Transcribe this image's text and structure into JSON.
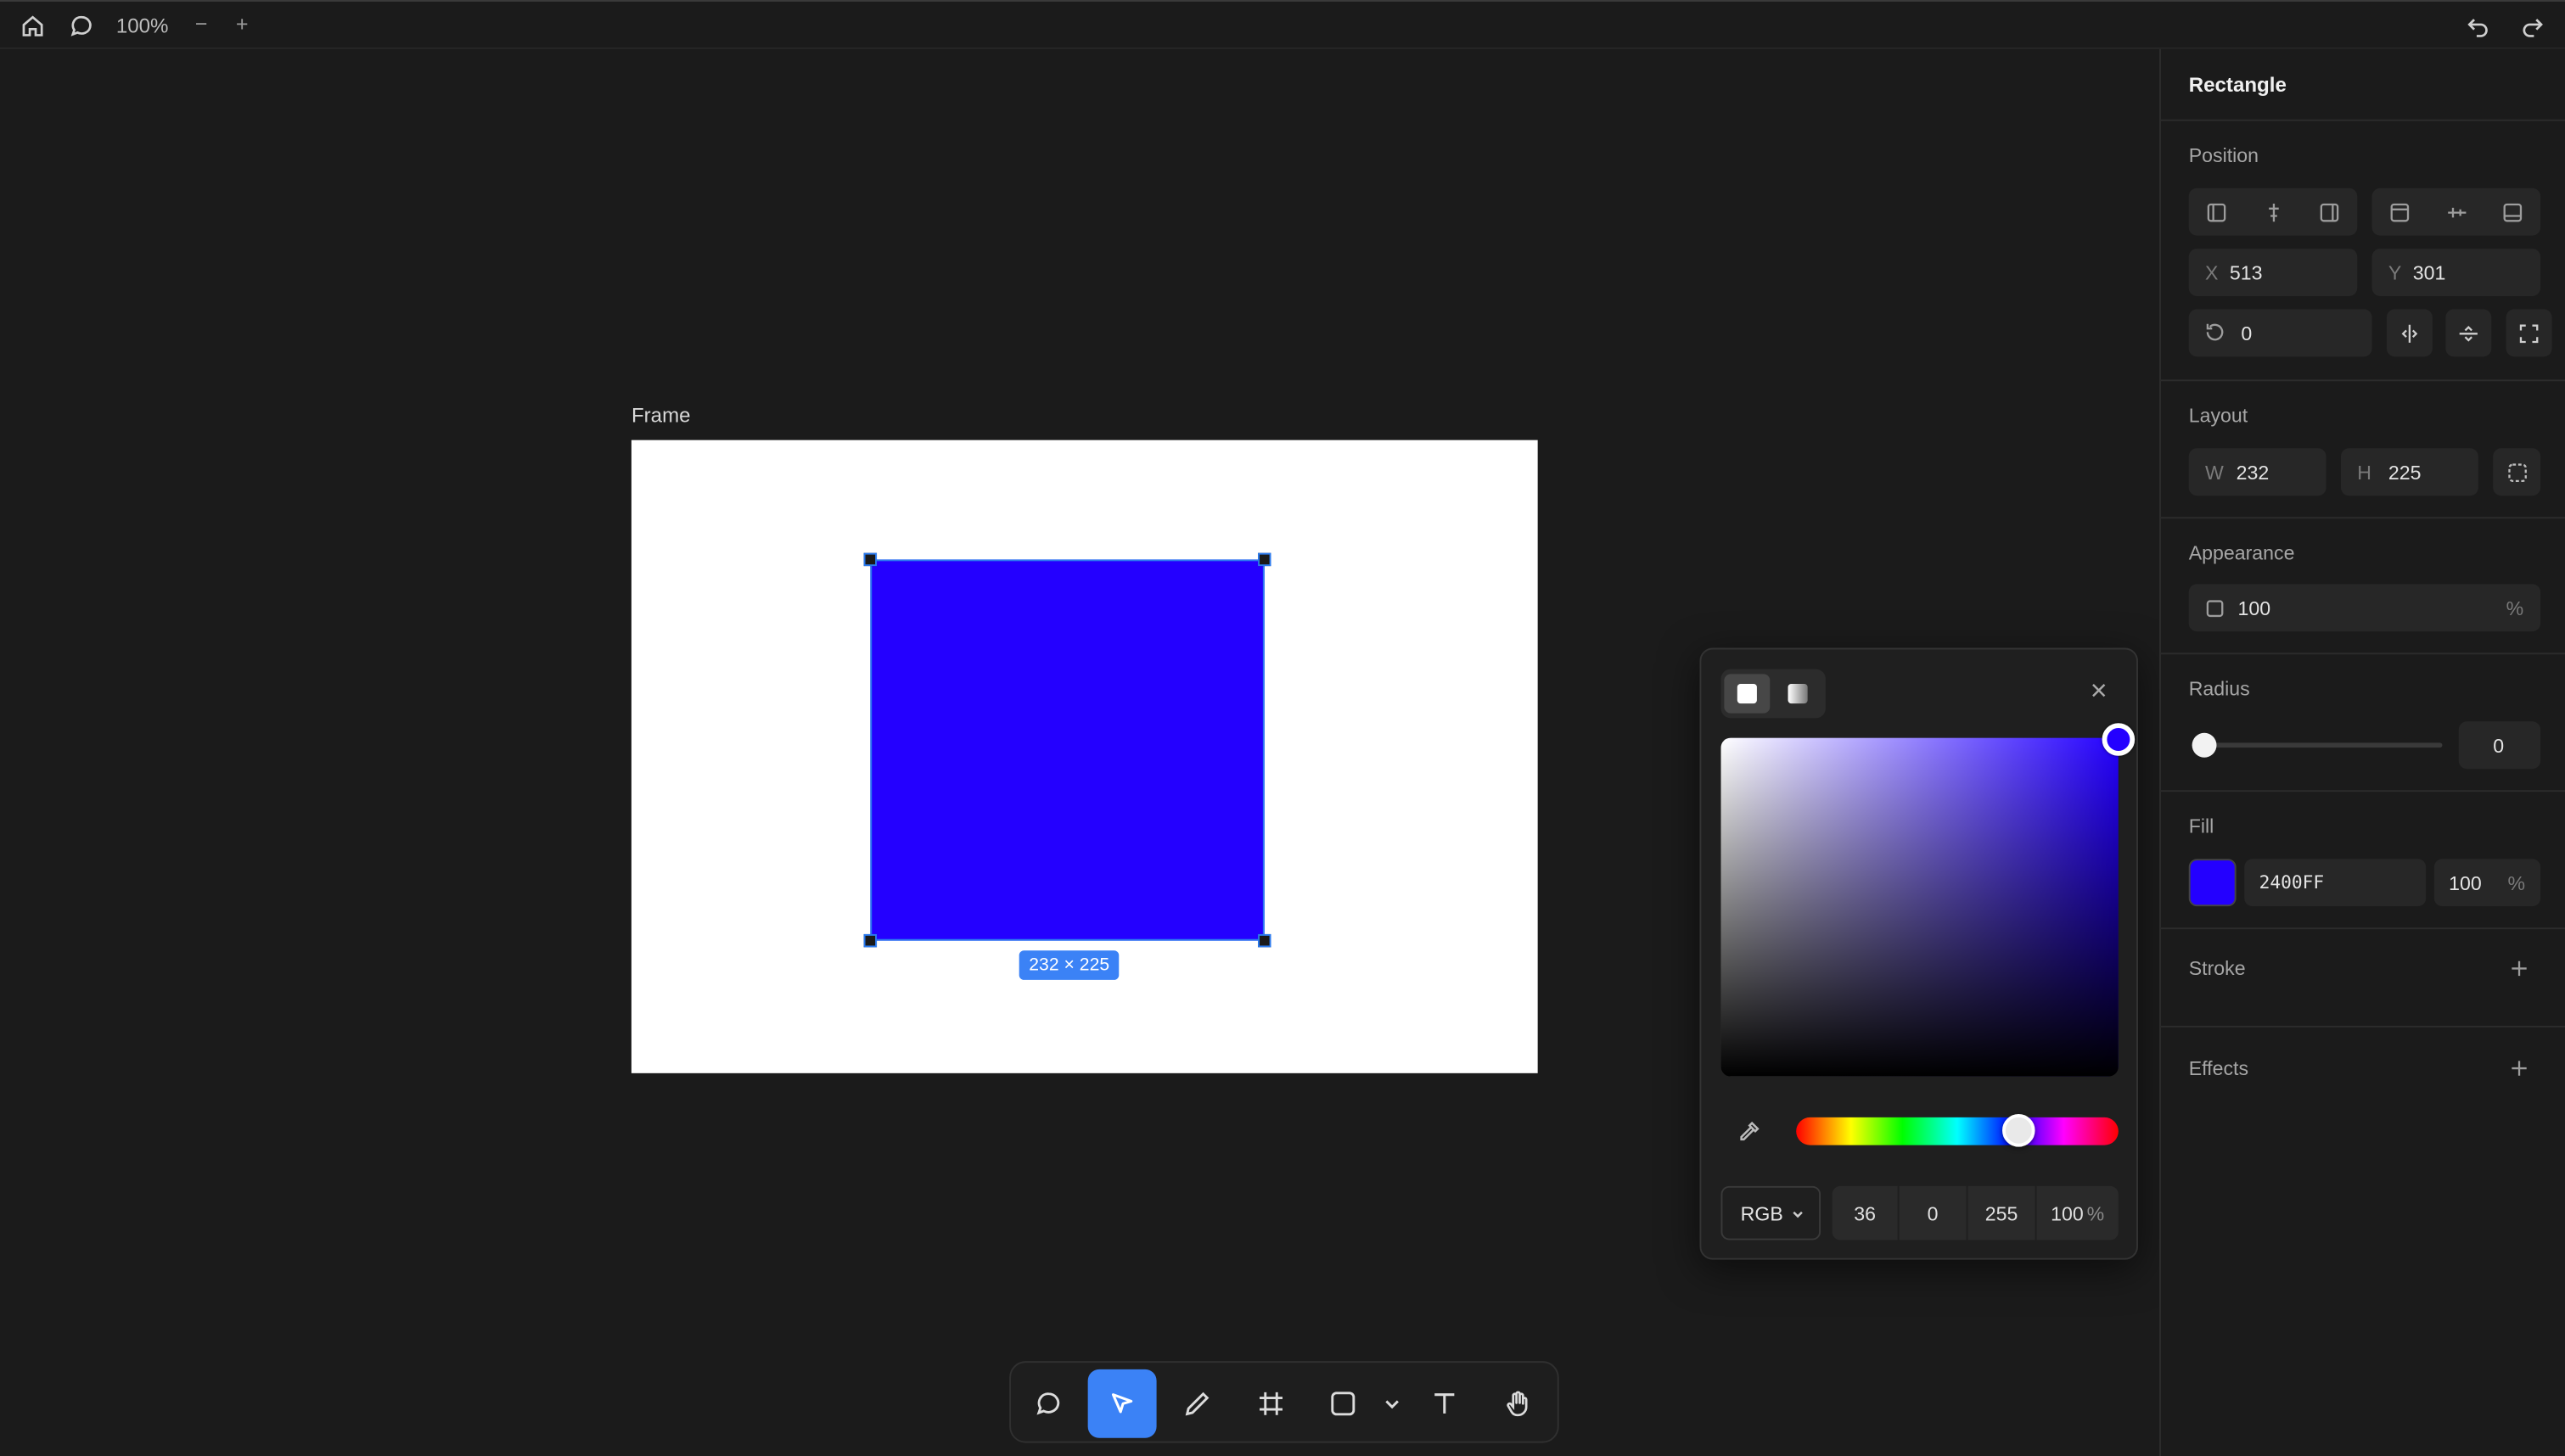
{
  "topbar": {
    "zoom": "100%",
    "zoom_out": "−",
    "zoom_in": "+"
  },
  "canvas": {
    "frame_label": "Frame",
    "size_badge": "232 × 225",
    "shape_color": "#2400ff"
  },
  "color_picker": {
    "mode": "RGB",
    "r": "36",
    "g": "0",
    "b": "255",
    "alpha": "100",
    "alpha_unit": "%",
    "hue_value": "#2400ff"
  },
  "toolbar": {
    "tools": [
      "comment",
      "select",
      "pen",
      "frame",
      "rectangle",
      "shape-menu",
      "text",
      "hand"
    ],
    "active_tool": "select"
  },
  "panel": {
    "title": "Rectangle",
    "position": {
      "label": "Position",
      "x_key": "X",
      "x": "513",
      "y_key": "Y",
      "y": "301",
      "rotation": "0"
    },
    "layout": {
      "label": "Layout",
      "w_key": "W",
      "w": "232",
      "h_key": "H",
      "h": "225"
    },
    "appearance": {
      "label": "Appearance",
      "opacity": "100",
      "unit": "%"
    },
    "radius": {
      "label": "Radius",
      "value": "0"
    },
    "fill": {
      "label": "Fill",
      "hex": "2400FF",
      "opacity": "100",
      "unit": "%",
      "color": "#2400ff"
    },
    "stroke": {
      "label": "Stroke"
    },
    "effects": {
      "label": "Effects"
    }
  }
}
